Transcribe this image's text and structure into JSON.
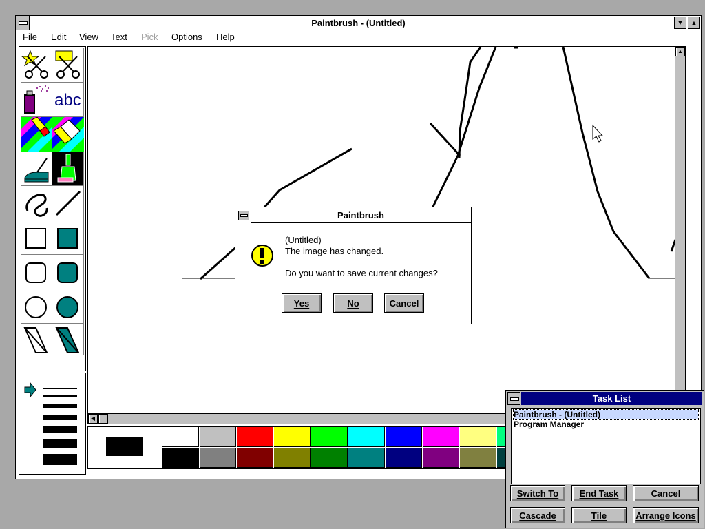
{
  "main_window": {
    "title": "Paintbrush - (Untitled)",
    "menu": [
      {
        "label": "File",
        "enabled": true
      },
      {
        "label": "Edit",
        "enabled": true
      },
      {
        "label": "View",
        "enabled": true
      },
      {
        "label": "Text",
        "enabled": true
      },
      {
        "label": "Pick",
        "enabled": false
      },
      {
        "label": "Options",
        "enabled": true
      },
      {
        "label": "Help",
        "enabled": true
      }
    ],
    "tools": [
      "scissors-star-tool",
      "scissors-rect-tool",
      "airbrush-tool",
      "text-tool",
      "color-eraser-tool",
      "eraser-tool",
      "paint-roller-tool",
      "brush-tool",
      "curve-tool",
      "line-tool",
      "box-tool",
      "filled-box-tool",
      "rounded-box-tool",
      "filled-rounded-box-tool",
      "circle-tool",
      "filled-circle-tool",
      "polygon-tool",
      "filled-polygon-tool"
    ],
    "text_tool_label": "abc",
    "palette": {
      "top": [
        "#ffffff",
        "#c0c0c0",
        "#ff0000",
        "#ffff00",
        "#00ff00",
        "#00ffff",
        "#0000ff",
        "#ff00ff",
        "#ffff80",
        "#00ff80"
      ],
      "bottom": [
        "#000000",
        "#808080",
        "#800000",
        "#808000",
        "#008000",
        "#008080",
        "#000080",
        "#800080",
        "#808040",
        "#004040"
      ]
    },
    "foreground_color": "#000000"
  },
  "dialog": {
    "title": "Paintbrush",
    "icon": "exclamation-icon",
    "lines": [
      "(Untitled)",
      "The image has changed.",
      "Do you want to save current changes?"
    ],
    "buttons": [
      {
        "label": "Yes",
        "hotkey": "Y"
      },
      {
        "label": "No",
        "hotkey": "N"
      },
      {
        "label": "Cancel",
        "hotkey": ""
      }
    ]
  },
  "task_list": {
    "title": "Task List",
    "items": [
      "Paintbrush - (Untitled)",
      "Program Manager"
    ],
    "selected_index": 0,
    "buttons_row1": [
      "Switch To",
      "End Task",
      "Cancel"
    ],
    "buttons_row2": [
      "Cascade",
      "Tile",
      "Arrange Icons"
    ]
  }
}
